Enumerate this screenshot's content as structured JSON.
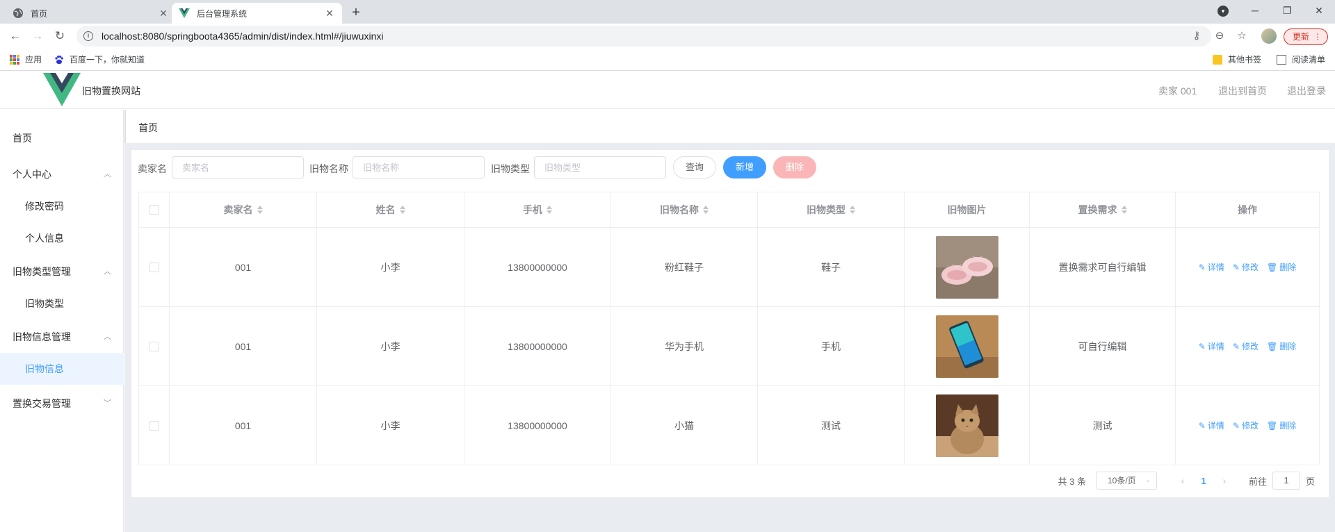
{
  "browser": {
    "tabs": [
      {
        "title": "首页",
        "active": false
      },
      {
        "title": "后台管理系统",
        "active": true
      }
    ],
    "url": "localhost:8080/springboota4365/admin/dist/index.html#/jiuwuxinxi",
    "update_label": "更新",
    "bookmarks": {
      "apps": "应用",
      "baidu": "百度一下，你就知道",
      "other": "其他书签",
      "reading": "阅读清单"
    }
  },
  "header": {
    "site_name": "旧物置换网站",
    "user": "卖家 001",
    "back_home": "退出到首页",
    "logout": "退出登录"
  },
  "sidebar": {
    "items": [
      {
        "label": "首页"
      },
      {
        "label": "个人中心"
      },
      {
        "label": "修改密码"
      },
      {
        "label": "个人信息"
      },
      {
        "label": "旧物类型管理"
      },
      {
        "label": "旧物类型"
      },
      {
        "label": "旧物信息管理"
      },
      {
        "label": "旧物信息"
      },
      {
        "label": "置换交易管理"
      }
    ]
  },
  "breadcrumb": "首页",
  "search": {
    "seller_label": "卖家名",
    "seller_placeholder": "卖家名",
    "item_label": "旧物名称",
    "item_placeholder": "旧物名称",
    "type_label": "旧物类型",
    "type_placeholder": "旧物类型",
    "query_btn": "查询",
    "add_btn": "新增",
    "delete_btn": "删除"
  },
  "table": {
    "headers": [
      "卖家名",
      "姓名",
      "手机",
      "旧物名称",
      "旧物类型",
      "旧物图片",
      "置换需求",
      "操作"
    ],
    "rows": [
      {
        "seller": "001",
        "name": "小李",
        "phone": "13800000000",
        "item": "粉红鞋子",
        "type": "鞋子",
        "demand": "置换需求可自行编辑",
        "image": "pink-shoes"
      },
      {
        "seller": "001",
        "name": "小李",
        "phone": "13800000000",
        "item": "华为手机",
        "type": "手机",
        "demand": "可自行编辑",
        "image": "phone"
      },
      {
        "seller": "001",
        "name": "小李",
        "phone": "13800000000",
        "item": "小猫",
        "type": "测试",
        "demand": "测试",
        "image": "cat"
      }
    ],
    "ops": {
      "detail": "详情",
      "edit": "修改",
      "delete": "删除"
    }
  },
  "pagination": {
    "total": "共 3 条",
    "page_size": "10条/页",
    "current": "1",
    "goto_label": "前往",
    "goto_value": "1",
    "page_suffix": "页"
  },
  "colors": {
    "accent": "#409eff",
    "danger_light": "#fab6b6",
    "logo_green": "#41b883",
    "logo_dark": "#35495e"
  }
}
